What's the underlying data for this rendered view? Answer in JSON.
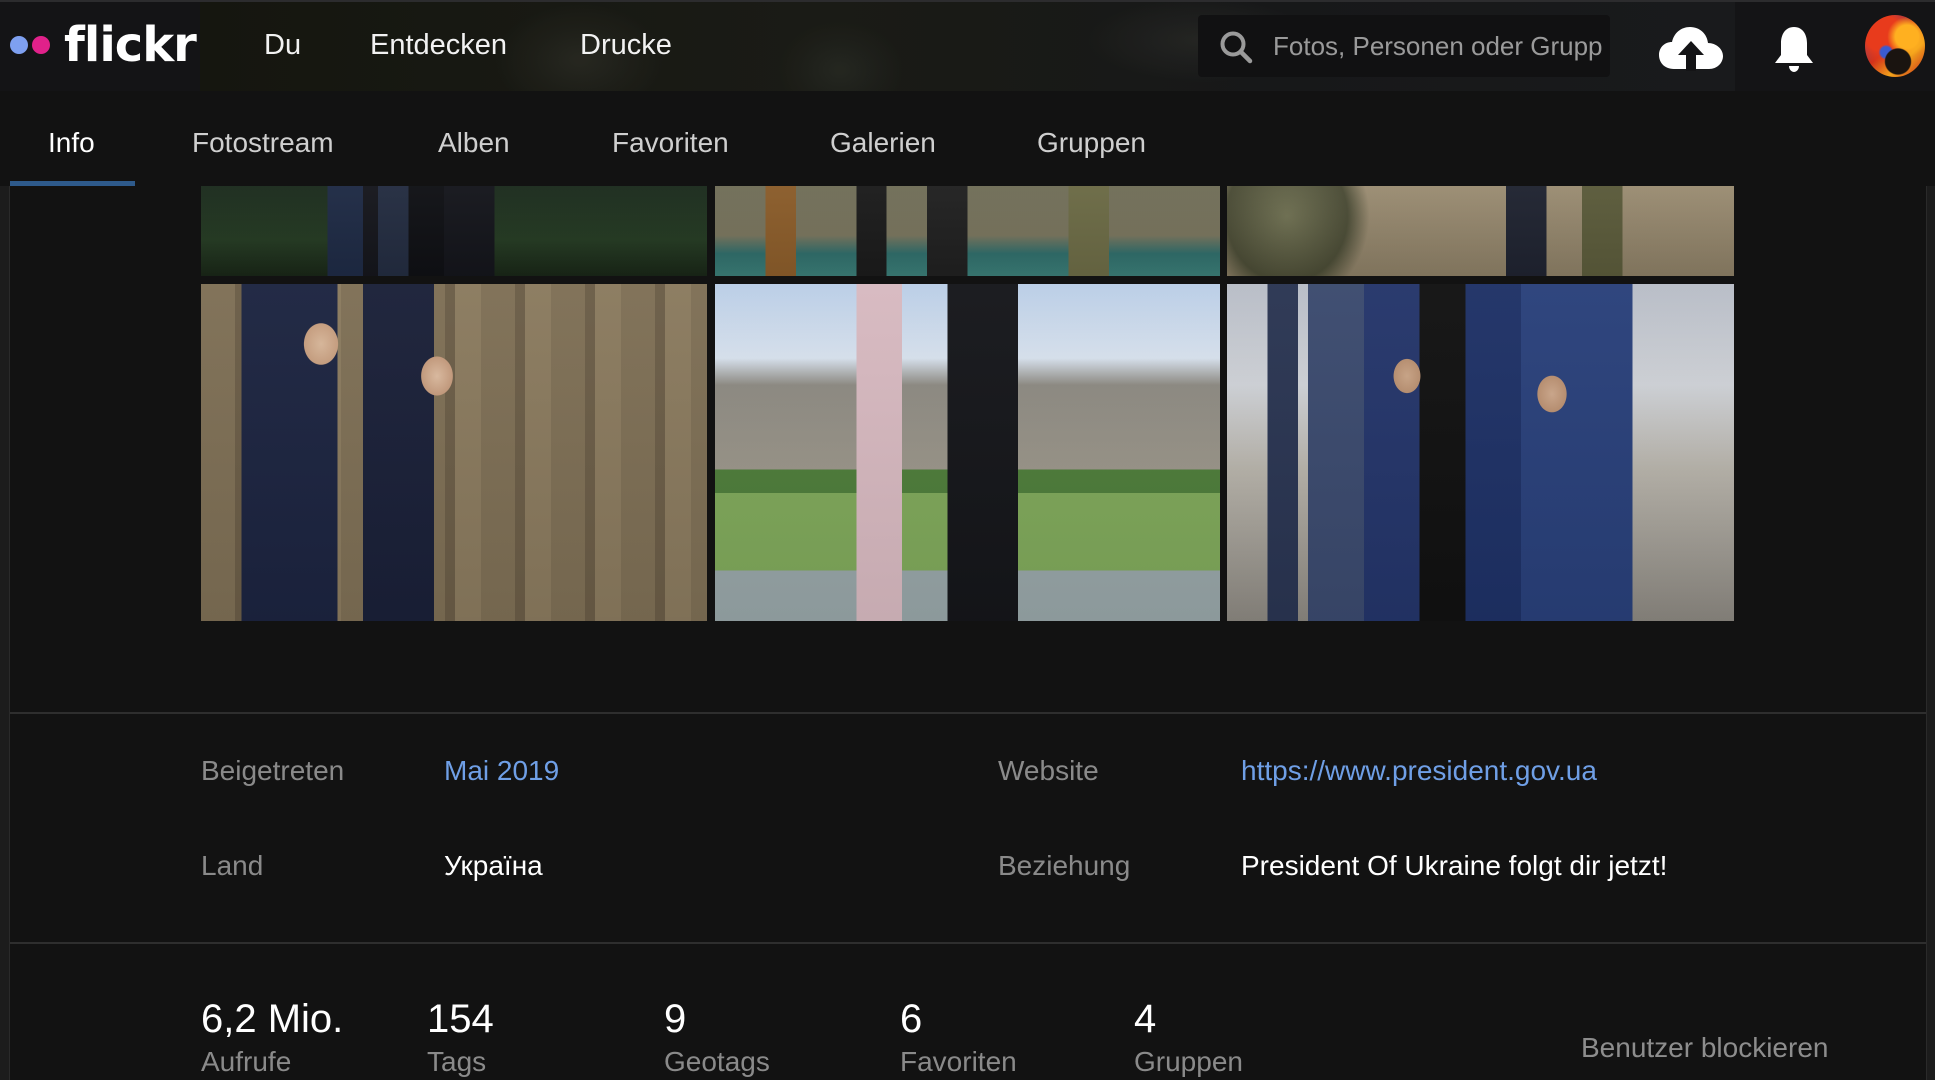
{
  "header": {
    "brand": "flickr",
    "brand_colors": {
      "dot_left": "#7ea0f0",
      "dot_right": "#e0218a"
    },
    "nav": [
      "Du",
      "Entdecken",
      "Drucke"
    ],
    "search": {
      "placeholder": "Fotos, Personen oder Gruppen",
      "icon": "search-icon"
    },
    "icons": [
      "cloud-upload-icon",
      "bell-icon",
      "avatar"
    ]
  },
  "tabs": {
    "items": [
      "Info",
      "Fotostream",
      "Alben",
      "Favoriten",
      "Galerien",
      "Gruppen"
    ],
    "active": "Info",
    "accent": "#2e5a8b"
  },
  "photos": [
    {
      "description": "Legs of men in suits walking on path with greenery"
    },
    {
      "description": "Feet of soldiers and officials walking on a path"
    },
    {
      "description": "Soldiers in camouflage on dirt ground"
    },
    {
      "description": "Two presidents walking past honor guard"
    },
    {
      "description": "Two people on a balcony viewing the Reichstag building"
    },
    {
      "description": "Group taking selfies with workers outside a building"
    }
  ],
  "info": {
    "joined": {
      "label": "Beigetreten",
      "value": "Mai 2019"
    },
    "website": {
      "label": "Website",
      "value": "https://www.president.gov.ua"
    },
    "country": {
      "label": "Land",
      "value": "Україна"
    },
    "relationship": {
      "label": "Beziehung",
      "value": "President Of Ukraine folgt dir jetzt!"
    },
    "link_color": "#6f9fe6"
  },
  "stats": [
    {
      "value": "6,2 Mio.",
      "label": "Aufrufe"
    },
    {
      "value": "154",
      "label": "Tags"
    },
    {
      "value": "9",
      "label": "Geotags"
    },
    {
      "value": "6",
      "label": "Favoriten"
    },
    {
      "value": "4",
      "label": "Gruppen"
    }
  ],
  "actions": {
    "block_user": "Benutzer blockieren"
  }
}
